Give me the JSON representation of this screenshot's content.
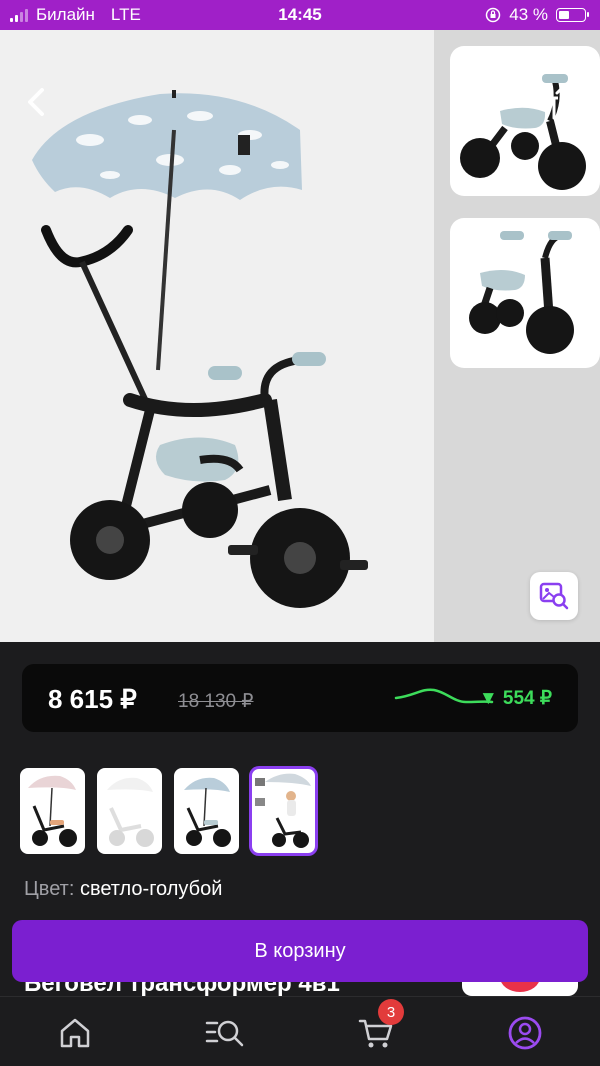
{
  "status_bar": {
    "carrier": "Билайн",
    "network": "LTE",
    "time": "14:45",
    "battery_percent": "43 %",
    "battery_level": 0.43
  },
  "gallery": {
    "icons": {
      "back": "chevron-left-icon",
      "favorite": "heart-icon",
      "share": "share-icon",
      "photo_search": "image-search-icon"
    },
    "thumbnails_count": 2
  },
  "price": {
    "current": "8 615 ₽",
    "old": "18 130 ₽",
    "drop": "▼ 554 ₽",
    "trend_color": "#3ddc5b"
  },
  "variants": {
    "selected_index": 3,
    "items": [
      "variant-1",
      "variant-2",
      "variant-3",
      "variant-4"
    ]
  },
  "color": {
    "label": "Цвет:",
    "value": "светло-голубой"
  },
  "actions": {
    "add_to_cart": "В корзину"
  },
  "product": {
    "title": "Беговел трансформер 4в1"
  },
  "nav": {
    "cart_badge": "3",
    "items": [
      "home-icon",
      "catalog-search-icon",
      "cart-icon",
      "profile-icon"
    ]
  },
  "colors": {
    "brand": "#7b1fd0",
    "status_bar": "#a020c8",
    "accent_green": "#3ddc5b",
    "badge": "#e23b3b"
  }
}
